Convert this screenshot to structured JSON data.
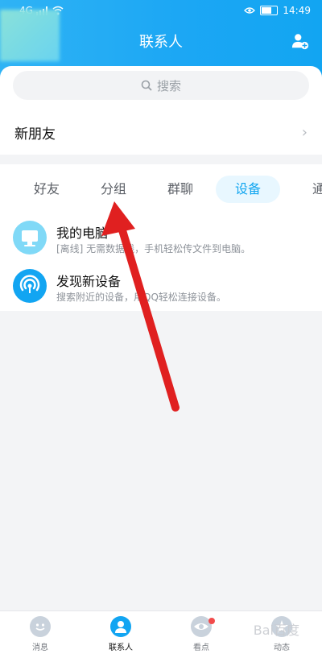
{
  "status": {
    "network": "4G",
    "time": "14:49"
  },
  "header": {
    "title": "联系人"
  },
  "search": {
    "placeholder": "搜索"
  },
  "new_friends": {
    "label": "新朋友"
  },
  "tabs": [
    {
      "label": "好友",
      "active": false
    },
    {
      "label": "分组",
      "active": false
    },
    {
      "label": "群聊",
      "active": false
    },
    {
      "label": "设备",
      "active": true
    },
    {
      "label": "通讯",
      "active": false
    }
  ],
  "devices": [
    {
      "title": "我的电脑",
      "subtitle": "[离线] 无需数据线，手机轻松传文件到电脑。"
    },
    {
      "title": "发现新设备",
      "subtitle": "搜索附近的设备，用QQ轻松连接设备。"
    }
  ],
  "bottom_nav": [
    {
      "label": "消息"
    },
    {
      "label": "联系人"
    },
    {
      "label": "看点"
    },
    {
      "label": "动态"
    }
  ],
  "watermark": "Bai百度"
}
